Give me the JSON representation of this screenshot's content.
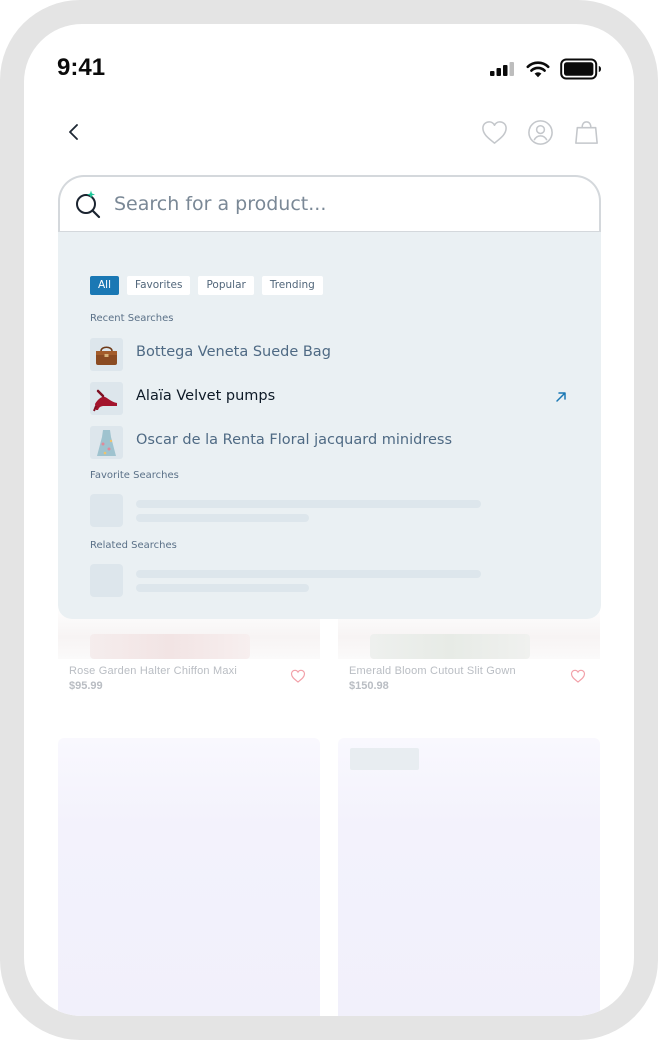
{
  "status_bar": {
    "time": "9:41"
  },
  "nav": {
    "back_icon": "chevron-left-icon",
    "icons": [
      "heart-icon",
      "user-icon",
      "bag-icon"
    ]
  },
  "search": {
    "placeholder": "Search for a product...",
    "value": ""
  },
  "filters": {
    "chips": [
      {
        "label": "All",
        "active": true
      },
      {
        "label": "Favorites",
        "active": false
      },
      {
        "label": "Popular",
        "active": false
      },
      {
        "label": "Trending",
        "active": false
      }
    ]
  },
  "recent": {
    "label": "Recent Searches",
    "items": [
      {
        "text": "Bottega Veneta Suede Bag",
        "thumb": "bag-thumbnail"
      },
      {
        "text": "Alaïa Velvet pumps",
        "thumb": "pumps-thumbnail",
        "highlighted": true
      },
      {
        "text": "Oscar de la Renta Floral jacquard minidress",
        "thumb": "dress-thumbnail"
      }
    ]
  },
  "favorite": {
    "label": "Favorite Searches"
  },
  "related": {
    "label": "Related Searches"
  },
  "products": [
    {
      "name": "Rose Garden Halter Chiffon Maxi",
      "price": "$95.99"
    },
    {
      "name": "Emerald Bloom Cutout Slit Gown",
      "price": "$150.98"
    }
  ],
  "colors": {
    "accent": "#1a78b4",
    "dropdown_bg": "#eaf0f3",
    "heart": "#f2a0a8"
  }
}
